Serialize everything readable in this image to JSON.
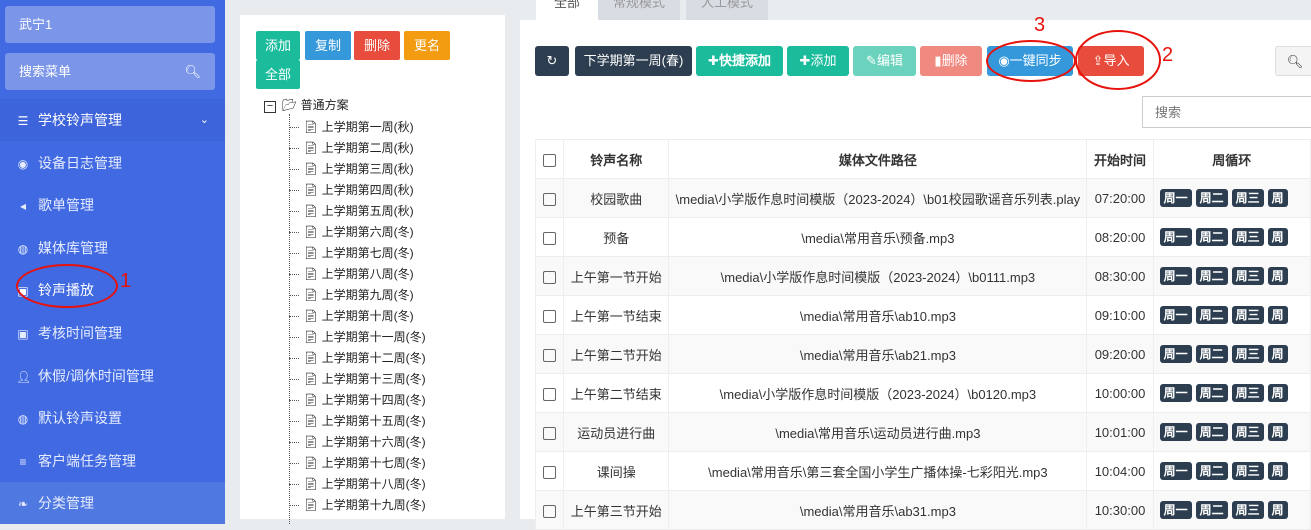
{
  "sidebar": {
    "user": "武宁1",
    "search_placeholder": "搜索菜单",
    "items": [
      {
        "label": "学校铃声管理",
        "icon": "list-icon"
      },
      {
        "label": "设备日志管理",
        "icon": "dashboard-icon"
      },
      {
        "label": "歌单管理",
        "icon": "volume-icon"
      },
      {
        "label": "媒体库管理",
        "icon": "globe-icon"
      },
      {
        "label": "铃声播放",
        "icon": "calendar-icon"
      },
      {
        "label": "考核时间管理",
        "icon": "calendar-icon"
      },
      {
        "label": "休假/调休时间管理",
        "icon": "user-x-icon"
      },
      {
        "label": "默认铃声设置",
        "icon": "globe-icon"
      },
      {
        "label": "客户端任务管理",
        "icon": "server-icon"
      },
      {
        "label": "分类管理",
        "icon": "leaf-icon"
      }
    ]
  },
  "tree_panel": {
    "buttons": {
      "add": "添加",
      "copy": "复制",
      "delete": "删除",
      "rename": "更名",
      "all": "全部"
    },
    "root": "普通方案",
    "nodes": [
      "上学期第一周(秋)",
      "上学期第二周(秋)",
      "上学期第三周(秋)",
      "上学期第四周(秋)",
      "上学期第五周(秋)",
      "上学期第六周(冬)",
      "上学期第七周(冬)",
      "上学期第八周(冬)",
      "上学期第九周(冬)",
      "上学期第十周(冬)",
      "上学期第十一周(冬)",
      "上学期第十二周(冬)",
      "上学期第十三周(冬)",
      "上学期第十四周(冬)",
      "上学期第十五周(冬)",
      "上学期第十六周(冬)",
      "上学期第十七周(冬)",
      "上学期第十八周(冬)",
      "上学期第十九周(冬)"
    ]
  },
  "tabs": [
    "全部",
    "常规模式",
    "人工模式"
  ],
  "toolbar": {
    "week": "下学期第一周(春)",
    "quick_add": "快捷添加",
    "add": "添加",
    "edit": "编辑",
    "delete": "删除",
    "sync": "一键同步",
    "import": "导入"
  },
  "search_placeholder": "搜索",
  "annotations": [
    "1",
    "2",
    "3"
  ],
  "table": {
    "headers": [
      "铃声名称",
      "媒体文件路径",
      "开始时间",
      "周循环"
    ],
    "days": [
      "周一",
      "周二",
      "周三",
      "周"
    ],
    "rows": [
      [
        "校园歌曲",
        "\\media\\小学版作息时间模版（2023-2024）\\b01校园歌谣音乐列表.play",
        "07:20:00"
      ],
      [
        "预备",
        "\\media\\常用音乐\\预备.mp3",
        "08:20:00"
      ],
      [
        "上午第一节开始",
        "\\media\\小学版作息时间模版（2023-2024）\\b0111.mp3",
        "08:30:00"
      ],
      [
        "上午第一节结束",
        "\\media\\常用音乐\\ab10.mp3",
        "09:10:00"
      ],
      [
        "上午第二节开始",
        "\\media\\常用音乐\\ab21.mp3",
        "09:20:00"
      ],
      [
        "上午第二节结束",
        "\\media\\小学版作息时间模版（2023-2024）\\b0120.mp3",
        "10:00:00"
      ],
      [
        "运动员进行曲",
        "\\media\\常用音乐\\运动员进行曲.mp3",
        "10:01:00"
      ],
      [
        "课间操",
        "\\media\\常用音乐\\第三套全国小学生广播体操-七彩阳光.mp3",
        "10:04:00"
      ],
      [
        "上午第三节开始",
        "\\media\\常用音乐\\ab31.mp3",
        "10:30:00"
      ]
    ]
  }
}
